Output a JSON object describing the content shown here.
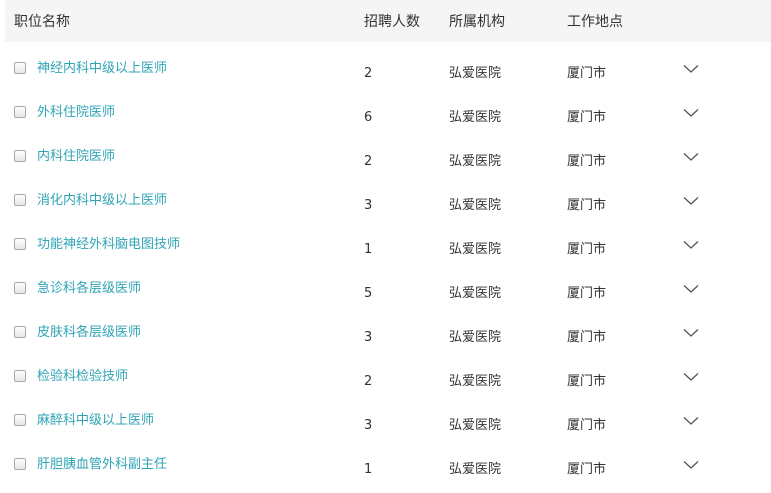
{
  "header": {
    "title": "职位名称",
    "count": "招聘人数",
    "org": "所属机构",
    "location": "工作地点"
  },
  "rows": [
    {
      "title": "神经内科中级以上医师",
      "count": "2",
      "org": "弘爱医院",
      "location": "厦门市"
    },
    {
      "title": "外科住院医师",
      "count": "6",
      "org": "弘爱医院",
      "location": "厦门市"
    },
    {
      "title": "内科住院医师",
      "count": "2",
      "org": "弘爱医院",
      "location": "厦门市"
    },
    {
      "title": "消化内科中级以上医师",
      "count": "3",
      "org": "弘爱医院",
      "location": "厦门市"
    },
    {
      "title": "功能神经外科脑电图技师",
      "count": "1",
      "org": "弘爱医院",
      "location": "厦门市"
    },
    {
      "title": "急诊科各层级医师",
      "count": "5",
      "org": "弘爱医院",
      "location": "厦门市"
    },
    {
      "title": "皮肤科各层级医师",
      "count": "3",
      "org": "弘爱医院",
      "location": "厦门市"
    },
    {
      "title": "检验科检验技师",
      "count": "2",
      "org": "弘爱医院",
      "location": "厦门市"
    },
    {
      "title": "麻醉科中级以上医师",
      "count": "3",
      "org": "弘爱医院",
      "location": "厦门市"
    },
    {
      "title": "肝胆胰血管外科副主任",
      "count": "1",
      "org": "弘爱医院",
      "location": "厦门市"
    }
  ],
  "colors": {
    "link": "#2fa4b5",
    "header_bg": "#f5f5f5",
    "text": "#333333"
  },
  "icons": {
    "expand": "chevron-down-icon",
    "select": "checkbox"
  }
}
